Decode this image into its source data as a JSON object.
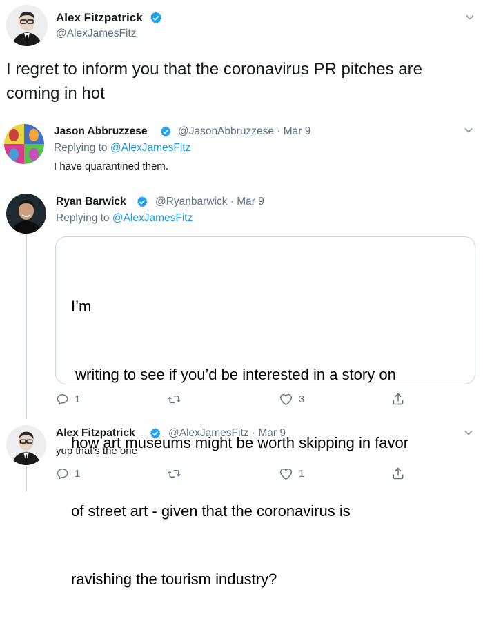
{
  "main_tweet": {
    "name": "Alex Fitzpatrick",
    "handle": "@AlexJamesFitz",
    "text": "I regret to inform you that the coronavirus PR pitches are coming in hot"
  },
  "replies": [
    {
      "name": "Jason Abbruzzese",
      "handle": "@JasonAbbruzzese",
      "dot": "·",
      "date": "Mar 9",
      "replying_label": "Replying to",
      "replying_to": "@AlexJamesFitz",
      "text": "I have quarantined them."
    },
    {
      "name": "Ryan Barwick",
      "handle": "@Ryanbarwick",
      "dot": "·",
      "date": "Mar 9",
      "replying_label": "Replying to",
      "replying_to": "@AlexJamesFitz",
      "image_text_lines": [
        "I’m",
        " writing to see if you’d be interested in a story on",
        "how art museums might be worth skipping in favor",
        "of street art - given that the coronavirus is",
        "ravishing the tourism industry?"
      ],
      "reply_count": "1",
      "like_count": "3"
    },
    {
      "name": "Alex Fitzpatrick",
      "handle": "@AlexJamesFitz",
      "dot": "·",
      "date": "Mar 9",
      "text": "yup that's the one",
      "reply_count": "1",
      "like_count": "1"
    }
  ],
  "icons": {
    "verified": "verified-badge-icon",
    "chevron": "chevron-down-icon",
    "reply": "reply-icon",
    "retweet": "retweet-icon",
    "like": "heart-icon",
    "share": "share-icon"
  },
  "colors": {
    "link": "#1b95e0",
    "verified": "#1da1f2",
    "secondary_text": "#5b7083"
  }
}
